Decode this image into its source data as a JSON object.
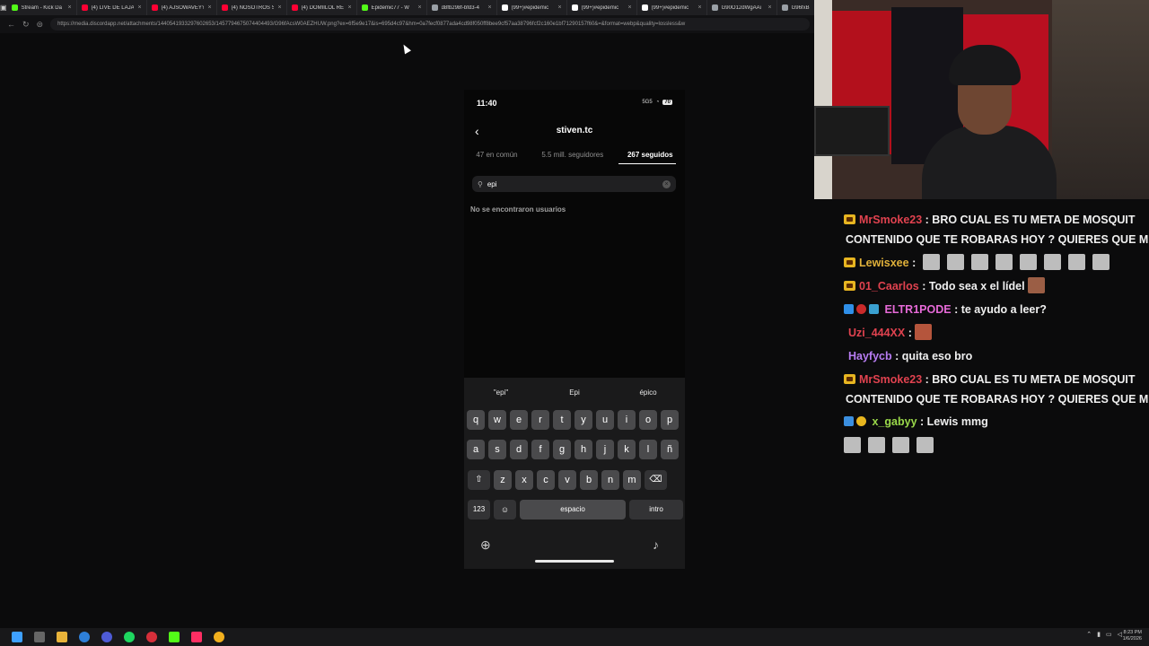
{
  "browser": {
    "tabs": [
      {
        "label": "Stream - Kick Da",
        "color": "#53fc18"
      },
      {
        "label": "(4) LIVE DE LAJA",
        "color": "#ff0033"
      },
      {
        "label": "(4) AJSOWAVEYY",
        "color": "#ff0033"
      },
      {
        "label": "(4) NOSOTROS SI",
        "color": "#ff0033"
      },
      {
        "label": "(4) DOMIILOL RE",
        "color": "#ff0033"
      },
      {
        "label": "Epidemic77 - W",
        "color": "#53fc18"
      },
      {
        "label": "d8fb298f-bfd3-4",
        "color": "#9aa0a6"
      },
      {
        "label": "(99+)#epidemic",
        "color": "#ffffff"
      },
      {
        "label": "(99+)#epidemic",
        "color": "#ffffff"
      },
      {
        "label": "(99+)#epidemic",
        "color": "#ffffff"
      },
      {
        "label": "G90O12dWgAAi",
        "color": "#9aa0a6"
      },
      {
        "label": "G96fxB",
        "color": "#9aa0a6"
      }
    ],
    "url": "https://media.discordapp.net/attachments/1440541933297602653/1457794675074404493/G96fAcsW0AEZHUW.png?ex=6f5e9e17&is=695d4c97&hm=0a7fecf0877ada4cd98f050ff8bee9cf57aa38796fcf2c160e1bf71290157f60&=&format=webp&quality=lossless&w"
  },
  "phone": {
    "status_time": "11:40",
    "status_signal": "5G5",
    "status_battery": "70",
    "username": "stiven.tc",
    "tabs": [
      "47 en común",
      "5.5 mill. seguidores",
      "267 seguidos"
    ],
    "search_value": "epi",
    "no_results": "No se encontraron usuarios",
    "suggestions": [
      "\"epi\"",
      "Epi",
      "épico"
    ],
    "rows": [
      [
        "q",
        "w",
        "e",
        "r",
        "t",
        "y",
        "u",
        "i",
        "o",
        "p"
      ],
      [
        "a",
        "s",
        "d",
        "f",
        "g",
        "h",
        "j",
        "k",
        "l",
        "ñ"
      ],
      [
        "z",
        "x",
        "c",
        "v",
        "b",
        "n",
        "m"
      ]
    ],
    "key_123": "123",
    "key_space": "espacio",
    "key_intro": "intro"
  },
  "chat": {
    "messages": [
      {
        "user": "MrSmoke23",
        "color": "#e0424f",
        "text": ": BRO CUAL ES TU META DE MOSQUIT",
        "cont": "CONTENIDO QUE TE ROBARAS HOY ? QUIERES QUE M"
      },
      {
        "user": "Lewisxee",
        "color": "#e0b13a",
        "text": ":"
      },
      {
        "user": "01_Caarlos",
        "color": "#e0424f",
        "text": ": Todo sea x el lídel"
      },
      {
        "user": "ELTR1PODE",
        "color": "#e76ad8",
        "text": ": te ayudo a leer?"
      },
      {
        "user": "Uzi_444XX",
        "color": "#e0424f",
        "text": ":"
      },
      {
        "user": "Hayfycb",
        "color": "#b77cf2",
        "text": ": quita eso bro"
      },
      {
        "user": "MrSmoke23",
        "color": "#e0424f",
        "text": ": BRO CUAL ES TU META DE MOSQUIT",
        "cont": "CONTENIDO QUE TE ROBARAS HOY ? QUIERES QUE M"
      },
      {
        "user": "x_gabyy",
        "color": "#9ad84a",
        "text": ": Lewis mmg"
      }
    ]
  },
  "taskbar": {
    "time": "8:23 PM",
    "date": "1/6/2026"
  }
}
